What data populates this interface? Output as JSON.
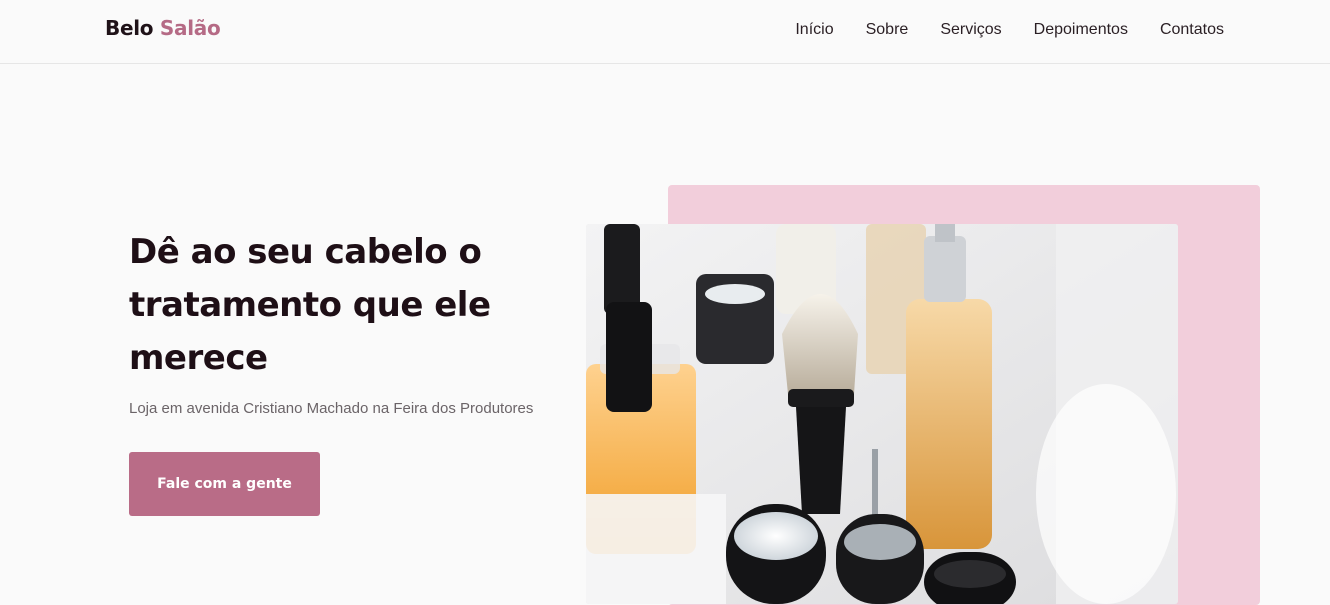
{
  "nav": {
    "logo_first": "Belo",
    "logo_second": "Salão",
    "links": [
      {
        "label": "Início"
      },
      {
        "label": "Sobre"
      },
      {
        "label": "Serviços"
      },
      {
        "label": "Depoimentos"
      },
      {
        "label": "Contatos"
      }
    ]
  },
  "hero": {
    "title": "Dê ao seu cabelo o tratamento que ele merece",
    "subtitle": "Loja em avenida Cristiano Machado na Feira dos Produtores",
    "cta_label": "Fale com a gente"
  },
  "colors": {
    "accent": "#b96c87",
    "pink_block": "#f2cedb",
    "text_dark": "#1e0f16"
  }
}
